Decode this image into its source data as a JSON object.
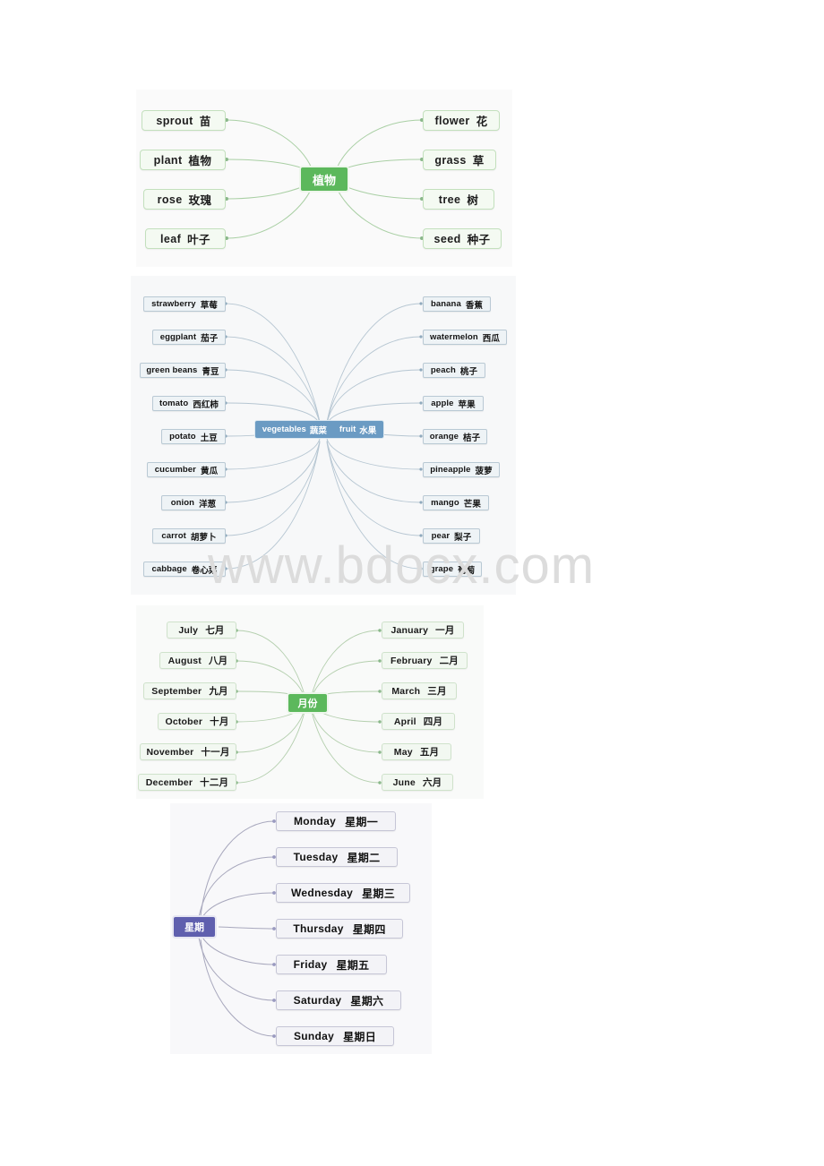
{
  "document": {
    "watermark": "www.bdocx.com",
    "background_color": "#ffffff"
  },
  "mindmaps": [
    {
      "id": "plants",
      "center": {
        "label": "植物",
        "color": "#5cb85c"
      },
      "left_branches": [
        {
          "en": "sprout",
          "zh": "苗"
        },
        {
          "en": "plant",
          "zh": "植物"
        },
        {
          "en": "rose",
          "zh": "玫瑰"
        },
        {
          "en": "leaf",
          "zh": "叶子"
        }
      ],
      "right_branches": [
        {
          "en": "flower",
          "zh": "花"
        },
        {
          "en": "grass",
          "zh": "草"
        },
        {
          "en": "tree",
          "zh": "树"
        },
        {
          "en": "seed",
          "zh": "种子"
        }
      ]
    },
    {
      "id": "produce",
      "center": {
        "label_en_1": "vegetables",
        "label_zh_1": "蔬菜",
        "label_en_2": "fruit",
        "label_zh_2": "水果",
        "color": "#6b9bc3"
      },
      "left_branches": [
        {
          "en": "strawberry",
          "zh": "草莓"
        },
        {
          "en": "eggplant",
          "zh": "茄子"
        },
        {
          "en": "green beans",
          "zh": "青豆"
        },
        {
          "en": "tomato",
          "zh": "西红柿"
        },
        {
          "en": "potato",
          "zh": "土豆"
        },
        {
          "en": "cucumber",
          "zh": "黄瓜"
        },
        {
          "en": "onion",
          "zh": "洋葱"
        },
        {
          "en": "carrot",
          "zh": "胡萝卜"
        },
        {
          "en": "cabbage",
          "zh": "卷心菜"
        }
      ],
      "right_branches": [
        {
          "en": "banana",
          "zh": "香蕉"
        },
        {
          "en": "watermelon",
          "zh": "西瓜"
        },
        {
          "en": "peach",
          "zh": "桃子"
        },
        {
          "en": "apple",
          "zh": "苹果"
        },
        {
          "en": "orange",
          "zh": "桔子"
        },
        {
          "en": "pineapple",
          "zh": "菠萝"
        },
        {
          "en": "mango",
          "zh": "芒果"
        },
        {
          "en": "pear",
          "zh": "梨子"
        },
        {
          "en": "grape",
          "zh": "葡萄"
        }
      ]
    },
    {
      "id": "months",
      "center": {
        "label": "月份",
        "color": "#5cb85c"
      },
      "left_branches": [
        {
          "en": "July",
          "zh": "七月"
        },
        {
          "en": "August",
          "zh": "八月"
        },
        {
          "en": "September",
          "zh": "九月"
        },
        {
          "en": "October",
          "zh": "十月"
        },
        {
          "en": "November",
          "zh": "十一月"
        },
        {
          "en": "December",
          "zh": "十二月"
        }
      ],
      "right_branches": [
        {
          "en": "January",
          "zh": "一月"
        },
        {
          "en": "February",
          "zh": "二月"
        },
        {
          "en": "March",
          "zh": "三月"
        },
        {
          "en": "April",
          "zh": "四月"
        },
        {
          "en": "May",
          "zh": "五月"
        },
        {
          "en": "June",
          "zh": "六月"
        }
      ]
    },
    {
      "id": "weekdays",
      "center": {
        "label": "星期",
        "color": "#5f5fae"
      },
      "right_branches": [
        {
          "en": "Monday",
          "zh": "星期一"
        },
        {
          "en": "Tuesday",
          "zh": "星期二"
        },
        {
          "en": "Wednesday",
          "zh": "星期三"
        },
        {
          "en": "Thursday",
          "zh": "星期四"
        },
        {
          "en": "Friday",
          "zh": "星期五"
        },
        {
          "en": "Saturday",
          "zh": "星期六"
        },
        {
          "en": "Sunday",
          "zh": "星期日"
        }
      ]
    }
  ]
}
